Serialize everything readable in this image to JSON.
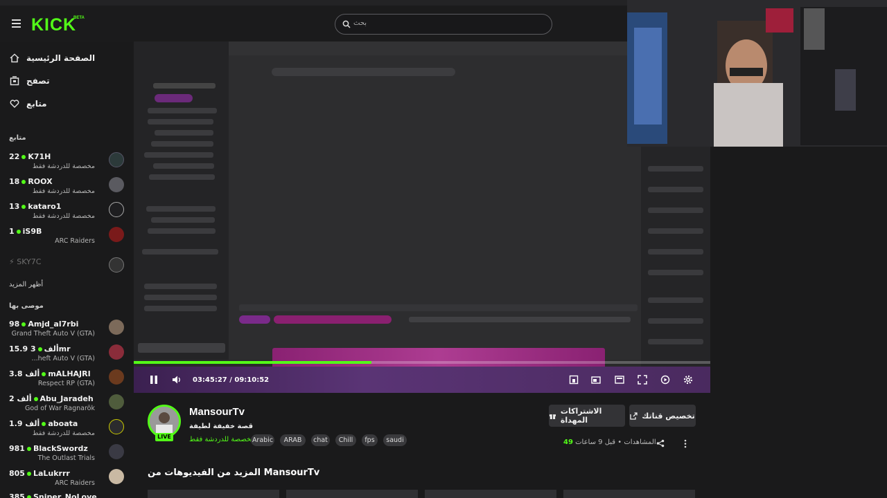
{
  "header": {
    "logo": "KICK",
    "logo_badge": "BETA",
    "search_placeholder": "بحث"
  },
  "sidebar": {
    "nav": [
      {
        "label": "الصفحة الرئيسية",
        "icon": "home-icon"
      },
      {
        "label": "تصفح",
        "icon": "browse-icon"
      },
      {
        "label": "متابع",
        "icon": "heart-icon"
      }
    ],
    "following_title": "متابع",
    "following": [
      {
        "count": "22",
        "name": "K71H",
        "category": "مخصصة للدردشة فقط"
      },
      {
        "count": "18",
        "name": "ROOX",
        "category": "مخصصة للدردشة فقط"
      },
      {
        "count": "13",
        "name": "kataro1",
        "category": "مخصصة للدردشة فقط"
      },
      {
        "count": "1",
        "name": "iS9B",
        "category": "ARC Raiders"
      },
      {
        "count": "",
        "name": "SKY7C",
        "category": ""
      }
    ],
    "show_more": "أظهر المزيد",
    "recommended_title": "موصى بها",
    "recommended": [
      {
        "count": "98",
        "name": "Amjd_al7rbi",
        "category": "Grand Theft Auto V (GTA)"
      },
      {
        "count": "15.9 ألف",
        "name": "3mr",
        "category": "...heft Auto V (GTA)"
      },
      {
        "count": "3.8 ألف",
        "name": "mALHAJRI",
        "category": "Respect RP (GTA)"
      },
      {
        "count": "2 ألف",
        "name": "Abu_Jaradeh",
        "category": "God of War Ragnarök"
      },
      {
        "count": "1.9 ألف",
        "name": "aboata",
        "category": "مخصصة للدردشة فقط"
      },
      {
        "count": "981",
        "name": "BlackSwordz",
        "category": "The Outlast Trials"
      },
      {
        "count": "805",
        "name": "LaLukrrr",
        "category": "ARC Raiders"
      },
      {
        "count": "385",
        "name": "Sniper_NoLove",
        "category": ""
      }
    ]
  },
  "player": {
    "current_time": "03:45:27",
    "separator": "/",
    "duration": "09:10:52",
    "progress": 0.4127
  },
  "channel": {
    "name": "MansourTv",
    "title": "قصة خفيفة لطيفة",
    "category": "مخصصة للدردشة فقط",
    "live": "LIVE",
    "tags": [
      "Arabic",
      "ARAB",
      "chat",
      "Chill",
      "fps",
      "saudi"
    ],
    "subscribe_gift": "الاشتراكات المهداة",
    "customize": "تخصيص قناتك",
    "time_ago": "قبل 9 ساعات",
    "views_label": "المشاهدات",
    "views": "49"
  },
  "more_videos": "المزيد من الفيديوهات من MansourTv",
  "colors": {
    "accent": "#53fc18",
    "bg": "#1a1a1b"
  }
}
